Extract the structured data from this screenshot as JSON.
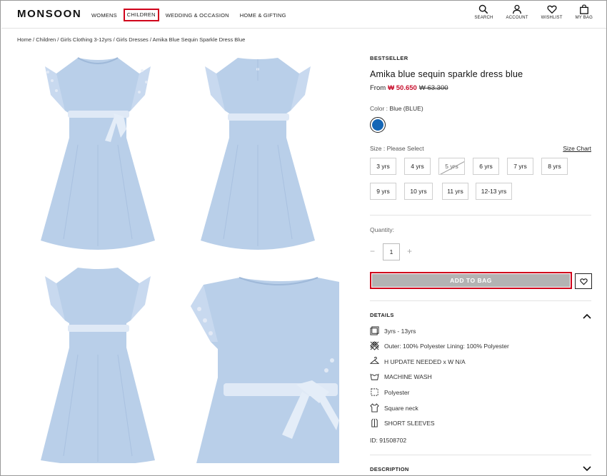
{
  "brand": {
    "logo": "MONSOON"
  },
  "nav": [
    {
      "label": "WOMENS"
    },
    {
      "label": "CHILDREN"
    },
    {
      "label": "WEDDING & OCCASION"
    },
    {
      "label": "HOME & GIFTING"
    }
  ],
  "header_icons": [
    {
      "label": "SEARCH",
      "icon": "search-icon"
    },
    {
      "label": "ACCOUNT",
      "icon": "account-icon"
    },
    {
      "label": "WISHLIST",
      "icon": "heart-icon"
    },
    {
      "label": "MY BAG",
      "icon": "bag-icon"
    }
  ],
  "breadcrumb": "Home / Children / Girls Clothing 3-12yrs / Girls Dresses / Amika Blue Sequin Sparkle Dress Blue",
  "product": {
    "badge": "BESTSELLER",
    "title": "Amika blue sequin sparkle dress blue",
    "price_prefix": "From",
    "price_now": "₩ 50.650",
    "price_was": "₩ 63.300",
    "color_label": "Color :",
    "color_value": "Blue (BLUE)",
    "swatch_color": "#1466b6",
    "size_label": "Size : Please Select",
    "size_chart": "Size Chart",
    "sizes": [
      {
        "label": "3 yrs"
      },
      {
        "label": "4 yrs"
      },
      {
        "label": "5 yrs",
        "out_of_stock": true
      },
      {
        "label": "6 yrs"
      },
      {
        "label": "7 yrs"
      },
      {
        "label": "8 yrs"
      },
      {
        "label": "9 yrs"
      },
      {
        "label": "10 yrs"
      },
      {
        "label": "11 yrs"
      },
      {
        "label": "12-13 yrs"
      }
    ],
    "quantity_label": "Quantity:",
    "quantity_minus": "−",
    "quantity_value": "1",
    "quantity_plus": "+",
    "add_to_bag": "ADD TO BAG",
    "details_heading": "DETAILS",
    "details": [
      {
        "icon": "size-icon",
        "text": "3yrs - 13yrs"
      },
      {
        "icon": "fabric-icon",
        "text": "Outer: 100% Polyester Lining: 100% Polyester"
      },
      {
        "icon": "hanger-icon",
        "text": "H UPDATE NEEDED x W N/A"
      },
      {
        "icon": "wash-icon",
        "text": "MACHINE WASH"
      },
      {
        "icon": "material-icon",
        "text": "Polyester"
      },
      {
        "icon": "neck-icon",
        "text": "Square neck"
      },
      {
        "icon": "sleeve-icon",
        "text": "SHORT SLEEVES"
      }
    ],
    "product_id": "ID: 91508702",
    "description_heading": "DESCRIPTION"
  },
  "colors": {
    "accent_red": "#d0021b",
    "price_red": "#c8102e",
    "dress_blue": "#b9cfe9",
    "button_grey": "#b3b3b3"
  }
}
